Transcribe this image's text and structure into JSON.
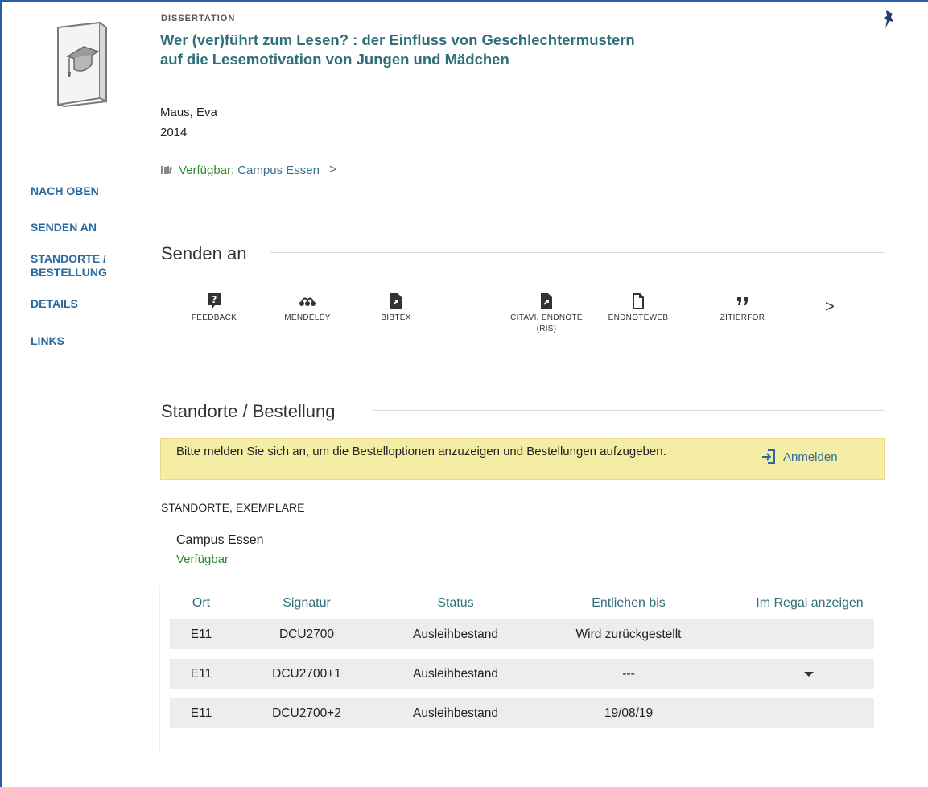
{
  "record": {
    "type": "DISSERTATION",
    "title": "Wer (ver)führt zum Lesen? : der Einfluss von Geschlechtermustern auf die Lesemotivation von Jungen und Mädchen",
    "author": "Maus, Eva",
    "year": "2014",
    "availability_status": "Verfügbar:",
    "availability_location": "Campus Essen",
    "availability_chevron": ">"
  },
  "nav": {
    "top": "NACH OBEN",
    "send_to": "SENDEN AN",
    "locations": "STANDORTE / BESTELLUNG",
    "details": "DETAILS",
    "links": "LINKS"
  },
  "send_section": {
    "heading": "Senden an",
    "items": [
      {
        "label": "FEEDBACK",
        "icon": "question-icon"
      },
      {
        "label": "MENDELEY",
        "icon": "mendeley-icon"
      },
      {
        "label": "BIBTEX",
        "icon": "file-export-icon"
      },
      {
        "label": "CITAVI, ENDNOTE (RIS)",
        "icon": "file-export-icon"
      },
      {
        "label": "ENDNOTEWEB",
        "icon": "document-icon"
      },
      {
        "label": "ZITIERFOR",
        "icon": "quote-icon"
      }
    ],
    "next": ">"
  },
  "locations_section": {
    "heading": "Standorte / Bestellung",
    "notice": "Bitte melden Sie sich an, um die Bestelloptionen anzuzeigen und Bestellungen aufzugeben.",
    "login_label": "Anmelden",
    "subheading": "STANDORTE, EXEMPLARE",
    "library": "Campus Essen",
    "library_status": "Verfügbar"
  },
  "holdings": {
    "columns": [
      "Ort",
      "Signatur",
      "Status",
      "Entliehen bis",
      "Im Regal anzeigen"
    ],
    "rows": [
      [
        "E11",
        "DCU2700",
        "Ausleihbestand",
        "Wird zurückgestellt",
        ""
      ],
      [
        "E11",
        "DCU2700+1",
        "Ausleihbestand",
        "---",
        ""
      ],
      [
        "E11",
        "DCU2700+2",
        "Ausleihbestand",
        "19/08/19",
        ""
      ]
    ]
  },
  "colors": {
    "title": "#2e6f7a",
    "link": "#2a6aa0",
    "available": "#2f8b2f",
    "notice_bg": "#f6eda5",
    "row_bg": "#ededed"
  }
}
